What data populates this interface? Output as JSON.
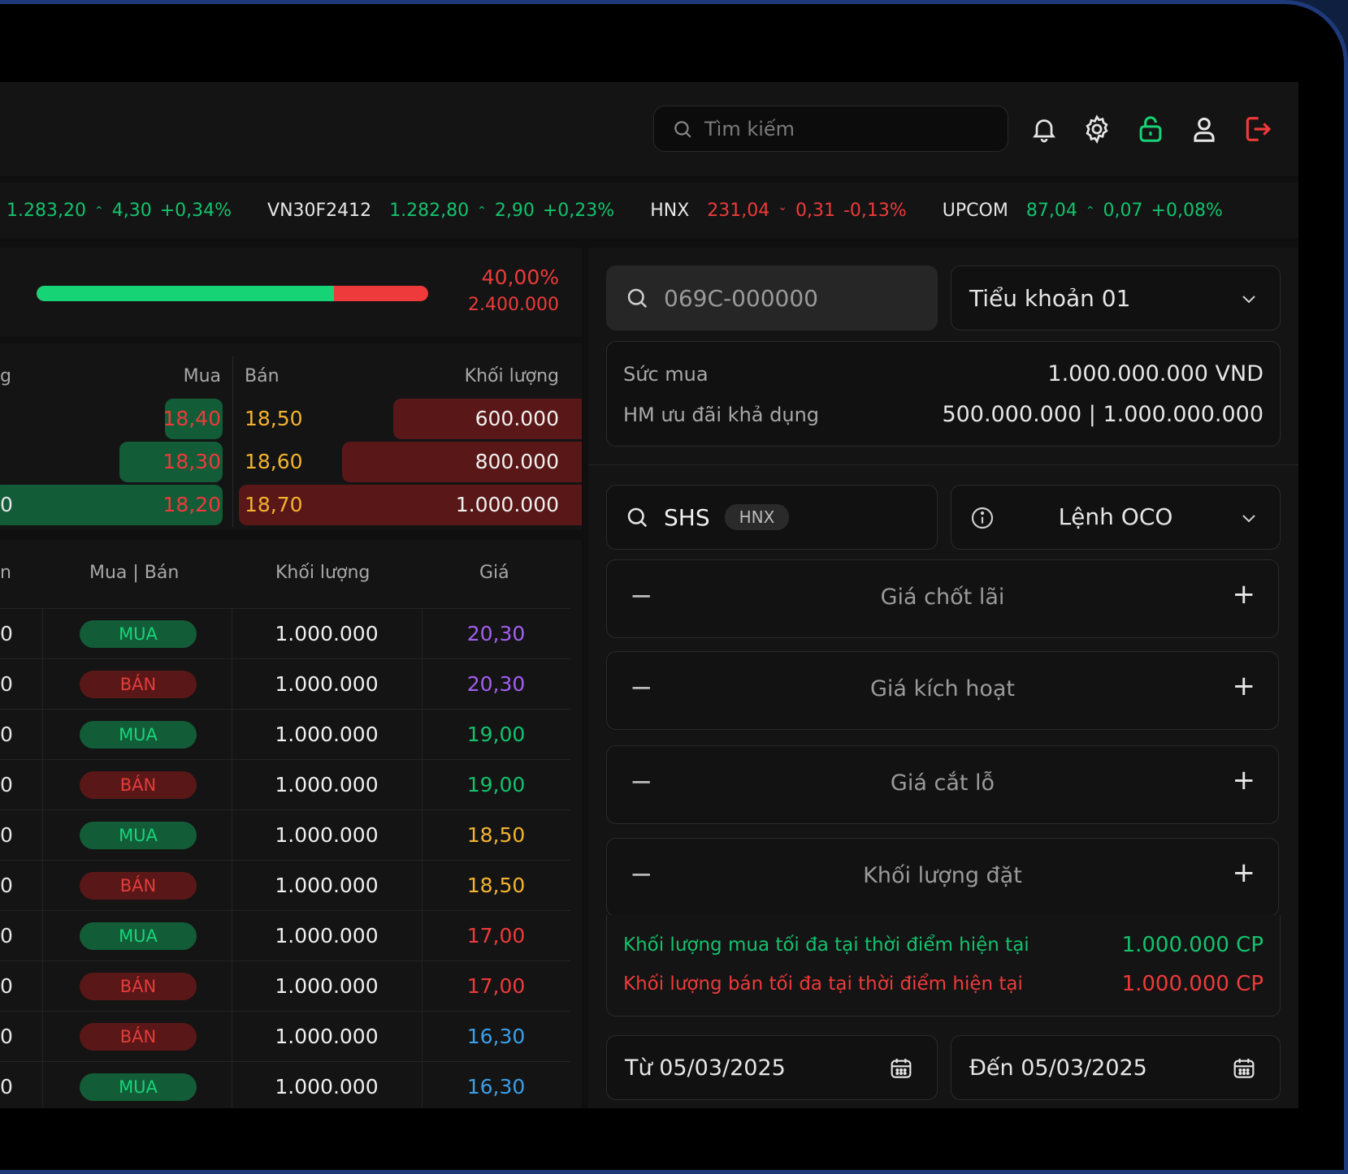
{
  "header": {
    "search_placeholder": "Tìm kiếm",
    "icons": [
      "bell-icon",
      "gear-icon",
      "unlock-icon",
      "user-icon",
      "logout-icon"
    ]
  },
  "ticker": [
    {
      "name": "",
      "value": "1.283,20",
      "change": "4,30",
      "pct": "+0,34%",
      "dir": "up"
    },
    {
      "name": "VN30F2412",
      "value": "1.282,80",
      "change": "2,90",
      "pct": "+0,23%",
      "dir": "up"
    },
    {
      "name": "HNX",
      "value": "231,04",
      "change": "0,31",
      "pct": "-0,13%",
      "dir": "down"
    },
    {
      "name": "UPCOM",
      "value": "87,04",
      "change": "0,07",
      "pct": "+0,08%",
      "dir": "up"
    }
  ],
  "ratio": {
    "percent_label": "40,00%",
    "volume": "2.400.000",
    "buy_fraction": 0.76
  },
  "orderbook": {
    "headers": {
      "left": "g",
      "buy": "Mua",
      "sell": "Bán",
      "volume": "Khối lượng"
    },
    "rows": [
      {
        "left": "",
        "buy": "18,40",
        "sell": "18,50",
        "volume": "600.000",
        "buy_fraction": 0.25,
        "sell_fraction": 0.55
      },
      {
        "left": "",
        "buy": "18,30",
        "sell": "18,60",
        "volume": "800.000",
        "buy_fraction": 0.45,
        "sell_fraction": 0.7
      },
      {
        "left": "0",
        "buy": "18,20",
        "sell": "18,70",
        "volume": "1.000.000",
        "buy_fraction": 1.0,
        "sell_fraction": 1.0
      }
    ]
  },
  "trades": {
    "headers": {
      "time": "n",
      "side": "Mua | Bán",
      "volume": "Khối lượng",
      "price": "Giá"
    },
    "rows": [
      {
        "time": "0",
        "side": "MUA",
        "volume": "1.000.000",
        "price": "20,30",
        "color": "p"
      },
      {
        "time": "0",
        "side": "BÁN",
        "volume": "1.000.000",
        "price": "20,30",
        "color": "p"
      },
      {
        "time": "0",
        "side": "MUA",
        "volume": "1.000.000",
        "price": "19,00",
        "color": "g"
      },
      {
        "time": "0",
        "side": "BÁN",
        "volume": "1.000.000",
        "price": "19,00",
        "color": "g"
      },
      {
        "time": "0",
        "side": "MUA",
        "volume": "1.000.000",
        "price": "18,50",
        "color": "y"
      },
      {
        "time": "0",
        "side": "BÁN",
        "volume": "1.000.000",
        "price": "18,50",
        "color": "y"
      },
      {
        "time": "0",
        "side": "MUA",
        "volume": "1.000.000",
        "price": "17,00",
        "color": "r"
      },
      {
        "time": "0",
        "side": "BÁN",
        "volume": "1.000.000",
        "price": "17,00",
        "color": "r"
      },
      {
        "time": "0",
        "side": "BÁN",
        "volume": "1.000.000",
        "price": "16,30",
        "color": "b"
      },
      {
        "time": "0",
        "side": "MUA",
        "volume": "1.000.000",
        "price": "16,30",
        "color": "b"
      }
    ]
  },
  "order": {
    "account_search": "069C-000000",
    "sub_account": "Tiểu khoản 01",
    "buying_power_label": "Sức mua",
    "buying_power_value": "1.000.000.000 VND",
    "limit_label": "HM ưu đãi khả dụng",
    "limit_value": "500.000.000 | 1.000.000.000",
    "symbol": "SHS",
    "exchange": "HNX",
    "order_type": "Lệnh OCO",
    "steppers": [
      "Giá chốt lãi",
      "Giá kích hoạt",
      "Giá cắt lỗ",
      "Khối lượng đặt"
    ],
    "max_buy_label": "Khối lượng mua tối đa tại thời điểm hiện tại",
    "max_buy_value": "1.000.000 CP",
    "max_sell_label": "Khối lượng bán tối đa tại thời điểm hiện tại",
    "max_sell_value": "1.000.000 CP",
    "from_date": "Từ 05/03/2025",
    "to_date": "Đến 05/03/2025"
  }
}
